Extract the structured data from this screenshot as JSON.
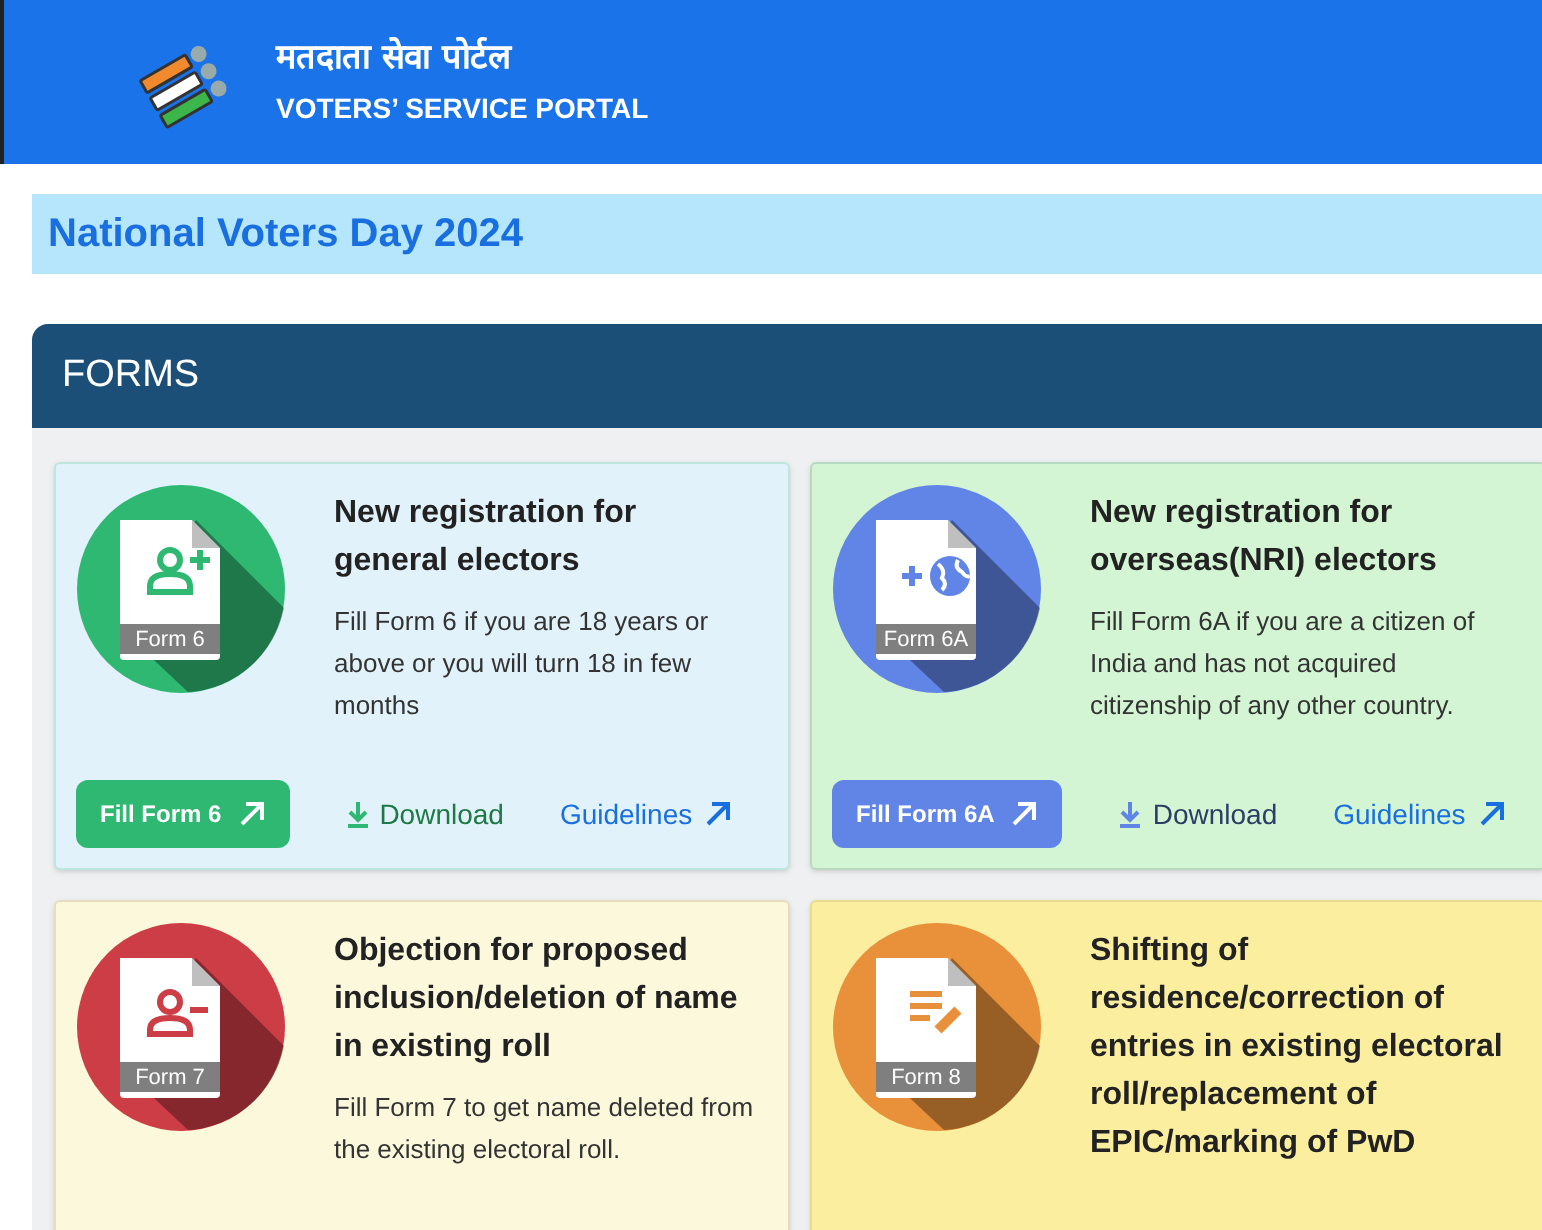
{
  "header": {
    "title_hindi": "मतदाता सेवा पोर्टल",
    "title": "VOTERS’ SERVICE PORTAL"
  },
  "banner": "National Voters Day 2024",
  "section": {
    "title": "FORMS"
  },
  "cards": [
    {
      "kind": "add-person",
      "color": "#2eb872",
      "form_label": "Form 6",
      "title": "New registration for general electors",
      "description": "Fill Form 6 if you are 18 years or above or you will turn 18 in few months",
      "fill_button": "Fill Form 6",
      "download": "Download",
      "guidelines": "Guidelines"
    },
    {
      "kind": "globe",
      "color": "#6185e6",
      "form_label": "Form 6A",
      "title": "New registration for overseas(NRI) electors",
      "description": "Fill Form 6A if you are a citizen of India and has not acquired citizenship of any other country.",
      "fill_button": "Fill Form 6A",
      "download": "Download",
      "guidelines": "Guidelines"
    },
    {
      "kind": "remove-person",
      "color": "#cc3d46",
      "form_label": "Form 7",
      "title": "Objection for proposed inclusion/deletion of name in existing roll",
      "description": "Fill Form 7 to get name deleted from the existing electoral roll."
    },
    {
      "kind": "edit",
      "color": "#e8913a",
      "form_label": "Form 8",
      "title": "Shifting of residence/correction of entries in existing electoral roll/replacement of EPIC/marking of PwD"
    }
  ]
}
